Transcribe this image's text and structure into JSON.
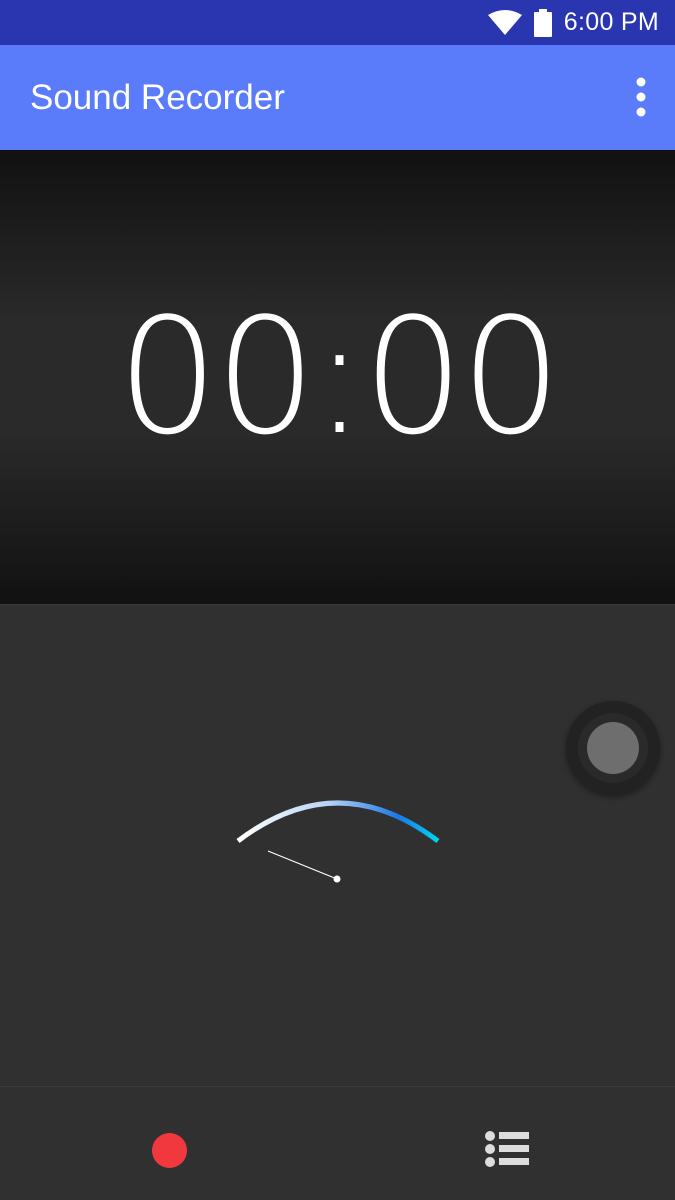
{
  "status_bar": {
    "time": "6:00 PM",
    "icons": [
      "wifi-icon",
      "battery-icon"
    ]
  },
  "app_bar": {
    "title": "Sound Recorder",
    "overflow_icon": "more-vert-icon"
  },
  "timer": {
    "value": "00:00"
  },
  "meter": {
    "icon": "vu-meter"
  },
  "controls": {
    "record_icon": "record-icon",
    "list_icon": "recordings-list-icon"
  },
  "colors": {
    "status_bar": "#2a35b0",
    "app_bar": "#5a7bfa",
    "background": "#303030",
    "record": "#f2383f",
    "meter_accent": "#00c8f0"
  }
}
